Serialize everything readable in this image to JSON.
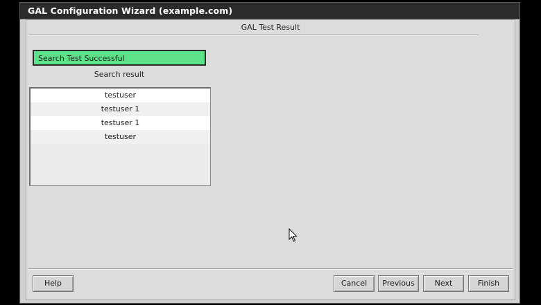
{
  "window": {
    "title": "GAL Configuration Wizard (example.com)"
  },
  "page": {
    "heading": "GAL Test Result"
  },
  "status": {
    "text": "Search Test Successful",
    "color": "#5ce38a"
  },
  "results": {
    "caption": "Search result",
    "rows": [
      "testuser",
      "testuser 1",
      "testuser 1",
      "testuser"
    ]
  },
  "buttons": {
    "help": "Help",
    "cancel": "Cancel",
    "previous": "Previous",
    "next": "Next",
    "finish": "Finish"
  },
  "colors": {
    "title_bar": "#2b2b2b",
    "dialog_bg": "#dcdcdc",
    "screen_bg": "#000000"
  }
}
